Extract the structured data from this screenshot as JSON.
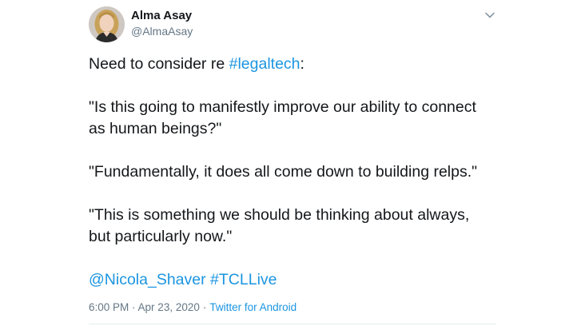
{
  "author": {
    "display_name": "Alma Asay",
    "handle": "@AlmaAsay"
  },
  "tweet": {
    "line1_prefix": "Need to consider re ",
    "line1_hashtag": "#legaltech",
    "line1_suffix": ":",
    "quote1_line1": "\"Is this going to manifestly improve our ability to connect",
    "quote1_line2": "as human beings?\"",
    "quote2": "\"Fundamentally, it does all come down to building relps.\"",
    "quote3_line1": "\"This is something we should be thinking about always,",
    "quote3_line2": "but particularly now.\"",
    "mention": "@Nicola_Shaver",
    "hashtag2": "#TCLLive"
  },
  "meta": {
    "time": "6:00 PM",
    "date_sep": " · ",
    "date": "Apr 23, 2020",
    "separator": "·",
    "source": "Twitter for Android"
  },
  "icons": {
    "menu": "chevron-down-icon",
    "avatar": "profile-photo"
  },
  "colors": {
    "link": "#1b95e0",
    "secondary_text": "#657786",
    "primary_text": "#14171a",
    "divider": "#e6ecf0"
  }
}
